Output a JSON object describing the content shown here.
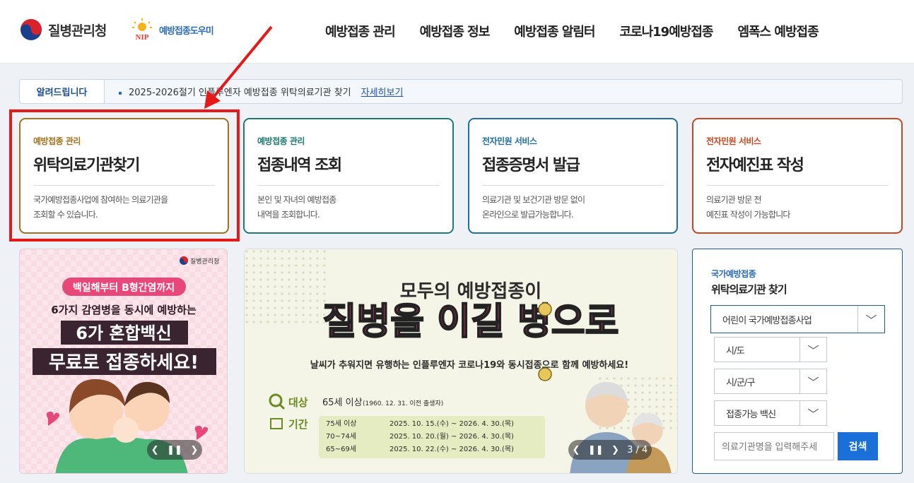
{
  "header": {
    "org_name": "질병관리청",
    "nip_name": "예방접종도우미",
    "nip_badge": "NIP",
    "nav": [
      "예방접종 관리",
      "예방접종 정보",
      "예방접종 알림터",
      "코로나19예방접종",
      "엠폭스 예방접종"
    ]
  },
  "notice": {
    "label": "알려드립니다",
    "text": "2025-2026절기 인플루엔자 예방접종 위탁의료기관 찾기",
    "more": "자세히보기"
  },
  "cards": [
    {
      "sub": "예방접종 관리",
      "title": "위탁의료기관찾기",
      "desc": "국가예방접종사업에 참여하는 의료기관을\n조회할 수 있습니다.",
      "color": "#a2701e"
    },
    {
      "sub": "예방접종 관리",
      "title": "접종내역 조회",
      "desc": "본인 및 자녀의 예방접종\n내역을 조회합니다.",
      "color": "#1e7a70"
    },
    {
      "sub": "전자민원 서비스",
      "title": "접종증명서 발급",
      "desc": "의료기관 및 보건기관 방문 없이\n온라인으로 발급가능합니다.",
      "color": "#1e6ea0"
    },
    {
      "sub": "전자민원 서비스",
      "title": "전자예진표 작성",
      "desc": "의료기관 방문 전\n예진표 작성이 가능합니다",
      "color": "#c8461e"
    }
  ],
  "banner1": {
    "org": "질병관리청",
    "line1": "백일해부터 B형간염까지",
    "line2": "6가지 감염병을 동시에 예방하는",
    "line3": "6가 혼합백신",
    "line4": "무료로 접종하세요!"
  },
  "banner2": {
    "head1": "모두의 예방접종이",
    "head2": "질병을 이길 병으로",
    "sub": "날씨가 추워지면 유행하는 인플루엔자 코로나19와 동시접종으로 함께 예방하세요!",
    "target_label": "대상",
    "target": "65세 이상",
    "target_note": "(1960. 12. 31. 이전 출생자)",
    "period_label": "기간",
    "rows": [
      {
        "age": "75세 이상",
        "range": "2025. 10. 15.(수) ~ 2026. 4. 30.(목)"
      },
      {
        "age": "70~74세",
        "range": "2025. 10. 20.(월) ~ 2026. 4. 30.(목)"
      },
      {
        "age": "65~69세",
        "range": "2025. 10. 22.(수) ~ 2026. 4. 30.(목)"
      }
    ],
    "page": "3 / 4"
  },
  "finder": {
    "caption": "국가예방접종",
    "title": "위탁의료기관 찾기",
    "program": "어린이 국가예방접종사업",
    "sido": "시/도",
    "sigungu": "시/군/구",
    "vaccine": "접종가능 백신",
    "placeholder": "의료기관명을 입력해주세",
    "search": "검색"
  }
}
